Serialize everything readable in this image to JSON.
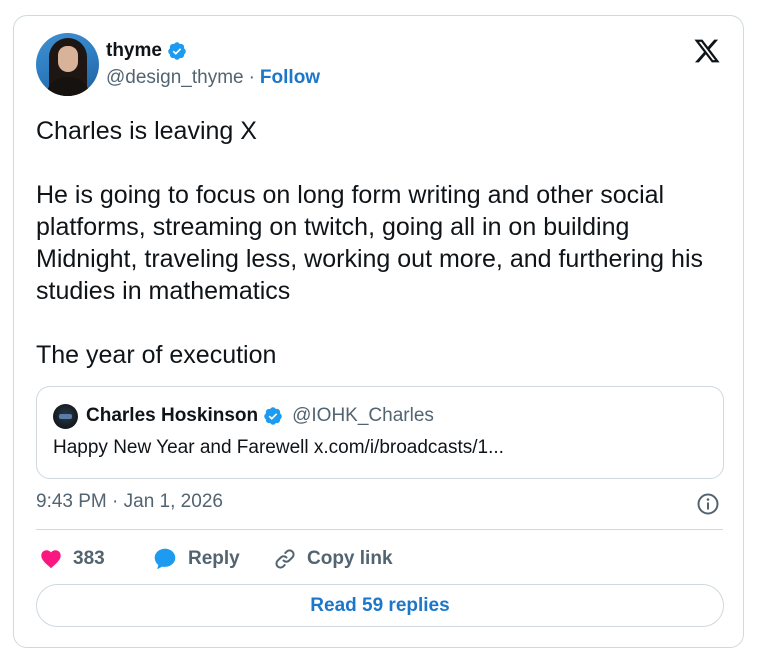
{
  "tweet": {
    "author_name": "thyme",
    "author_handle": "@design_thyme",
    "separator": "·",
    "follow_label": "Follow",
    "paragraphs": [
      "Charles is leaving X",
      "He is going to focus on long form writing and other social platforms, streaming on twitch, going all in on building Midnight, traveling less, working out more, and furthering his studies in mathematics",
      "The year of execution"
    ],
    "timestamp": "9:43 PM · Jan 1, 2026"
  },
  "quote": {
    "author_name": "Charles Hoskinson",
    "author_handle": "@IOHK_Charles",
    "text": "Happy New Year and Farewell x.com/i/broadcasts/1..."
  },
  "actions": {
    "like_count": "383",
    "reply_label": "Reply",
    "copy_label": "Copy link"
  },
  "read_replies_label": "Read 59 replies",
  "icons": {
    "verified": "verified-badge-icon",
    "x": "x-logo-icon",
    "info": "info-icon",
    "like": "heart-icon",
    "reply": "speech-bubble-icon",
    "copy": "link-icon"
  },
  "colors": {
    "accent": "#1d77c9",
    "verified": "#1d9bf0",
    "like": "#f91880",
    "text": "#0f1419",
    "muted": "#536471",
    "border": "#cfd9de"
  }
}
